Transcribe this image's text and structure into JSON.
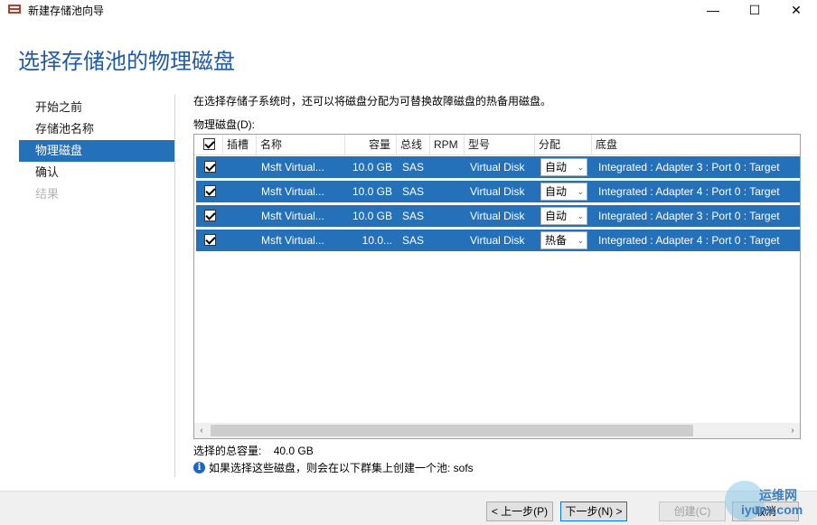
{
  "window": {
    "title": "新建存储池向导",
    "minimize": "—",
    "maximize": "☐",
    "close": "✕"
  },
  "header": {
    "title": "选择存储池的物理磁盘"
  },
  "nav": {
    "items": [
      {
        "label": "开始之前",
        "state": "normal"
      },
      {
        "label": "存储池名称",
        "state": "normal"
      },
      {
        "label": "物理磁盘",
        "state": "active"
      },
      {
        "label": "确认",
        "state": "normal"
      },
      {
        "label": "结果",
        "state": "disabled"
      }
    ]
  },
  "main": {
    "description": "在选择存储子系统时，还可以将磁盘分配为可替换故障磁盘的热备用磁盘。",
    "disk_label": "物理磁盘(D):",
    "columns": [
      "插槽",
      "名称",
      "容量",
      "总线",
      "RPM",
      "型号",
      "分配",
      "底盘"
    ],
    "rows": [
      {
        "checked": true,
        "slot": "",
        "name": "Msft Virtual...",
        "capacity": "10.0 GB",
        "bus": "SAS",
        "rpm": "",
        "model": "Virtual Disk",
        "allocation": "自动",
        "chassis": "Integrated : Adapter 3 : Port 0 : Target"
      },
      {
        "checked": true,
        "slot": "",
        "name": "Msft Virtual...",
        "capacity": "10.0 GB",
        "bus": "SAS",
        "rpm": "",
        "model": "Virtual Disk",
        "allocation": "自动",
        "chassis": "Integrated : Adapter 4 : Port 0 : Target"
      },
      {
        "checked": true,
        "slot": "",
        "name": "Msft Virtual...",
        "capacity": "10.0 GB",
        "bus": "SAS",
        "rpm": "",
        "model": "Virtual Disk",
        "allocation": "自动",
        "chassis": "Integrated : Adapter 3 : Port 0 : Target"
      },
      {
        "checked": true,
        "slot": "",
        "name": "Msft Virtual...",
        "capacity": "10.0...",
        "bus": "SAS",
        "rpm": "",
        "model": "Virtual Disk",
        "allocation": "热备",
        "chassis": "Integrated : Adapter 4 : Port 0 : Target"
      }
    ],
    "total_label": "选择的总容量:",
    "total_value": "40.0 GB",
    "info_text": "如果选择这些磁盘，则会在以下群集上创建一个池: sofs"
  },
  "footer": {
    "prev": "< 上一步(P)",
    "next": "下一步(N) >",
    "create": "创建(C)",
    "cancel": "取消"
  },
  "watermark": {
    "line1": "运维网",
    "line2": "iyunv.com"
  },
  "colors": {
    "accent": "#2470b9",
    "title": "#1e5aa8",
    "info": "#1f66c1"
  }
}
